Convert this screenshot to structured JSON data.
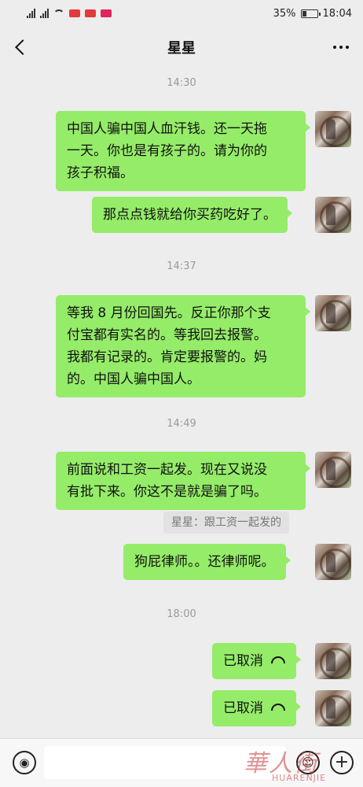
{
  "status_bar": {
    "battery_percent": "35%",
    "battery_level": 0.35,
    "time": "18:04",
    "app_badges": [
      "Weibo",
      "Weibo",
      "LINE"
    ]
  },
  "header": {
    "title": "星星",
    "back_icon": "chevron-left-icon",
    "more_icon": "more-dots-icon"
  },
  "messages": [
    {
      "type": "time",
      "text": "14:30"
    },
    {
      "type": "text",
      "from": "self",
      "text": "中国人骗中国人血汗钱。还一天拖\n一天。你也是有孩子的。请为你的\n孩子积福。"
    },
    {
      "type": "text",
      "from": "self",
      "text": "那点点钱就给你买药吃好了。"
    },
    {
      "type": "time",
      "text": "14:37"
    },
    {
      "type": "text",
      "from": "self",
      "text": "等我 8 月份回国先。反正你那个支\n付宝都有实名的。等我回去报警。\n我都有记录的。肯定要报警的。妈\n的。中国人骗中国人。"
    },
    {
      "type": "time",
      "text": "14:49"
    },
    {
      "type": "text",
      "from": "self",
      "text": "前面说和工资一起发。现在又说没\n有批下来。你这不是就是骗了吗。",
      "quote": "星星：跟工资一起发的"
    },
    {
      "type": "text",
      "from": "self",
      "text": "狗屁律师。。还律师呢。"
    },
    {
      "type": "time",
      "text": "18:00"
    },
    {
      "type": "call",
      "from": "self",
      "text": "已取消"
    },
    {
      "type": "call",
      "from": "self",
      "text": "已取消"
    }
  ],
  "input_bar": {
    "voice_icon": "voice-icon",
    "emoji_icon": "emoji-icon",
    "plus_icon": "plus-icon",
    "value": ""
  },
  "watermark": {
    "text": "華人街",
    "sub": "HUARENJIE"
  },
  "colors": {
    "background": "#ededed",
    "bubble_self": "#95ec69",
    "timestamp": "#9a9a9a"
  }
}
